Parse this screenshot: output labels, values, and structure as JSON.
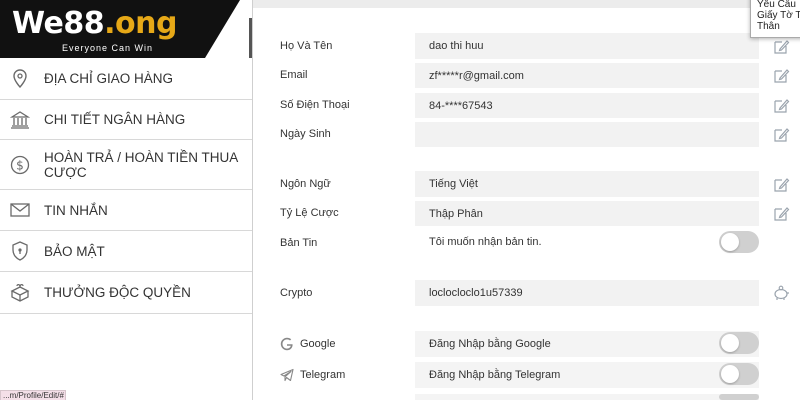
{
  "brand": {
    "name_main": "We88",
    "name_accent": ".ong",
    "tagline": "Everyone Can Win"
  },
  "sidebar": {
    "items": [
      {
        "label": "ĐỊA CHỈ GIAO HÀNG",
        "icon": "location-pin-icon"
      },
      {
        "label": "CHI TIẾT NGÂN HÀNG",
        "icon": "bank-icon"
      },
      {
        "label": "HOÀN TRẢ / HOÀN TIỀN THUA CƯỢC",
        "icon": "dollar-coin-icon"
      },
      {
        "label": "TIN NHẮN",
        "icon": "envelope-icon"
      },
      {
        "label": "BẢO MẬT",
        "icon": "shield-icon"
      },
      {
        "label": "THƯỞNG ĐỘC QUYỀN",
        "icon": "gift-box-icon"
      }
    ]
  },
  "profile": {
    "fields": [
      {
        "label": "Họ Và Tên",
        "value": "dao thi huu",
        "editable": true
      },
      {
        "label": "Email",
        "value": "zf*****r@gmail.com",
        "editable": true
      },
      {
        "label": "Số Điện Thoại",
        "value": "84-****67543",
        "editable": true
      },
      {
        "label": "Ngày Sinh",
        "value": "",
        "editable": true
      },
      {
        "label": "Ngôn Ngữ",
        "value": "Tiếng Việt",
        "editable": true
      },
      {
        "label": "Tỷ Lệ Cược",
        "value": "Thập Phân",
        "editable": true
      },
      {
        "label": "Bản Tin",
        "value": "Tôi muốn nhận bản tin.",
        "toggle_on": false
      },
      {
        "label": "Crypto",
        "value": "loclocloclo1u57339"
      }
    ],
    "social": [
      {
        "label": "Google",
        "value": "Đăng Nhập bằng Google",
        "icon": "google-icon",
        "toggle_on": false
      },
      {
        "label": "Telegram",
        "value": "Đăng Nhập bằng Telegram",
        "icon": "telegram-icon",
        "toggle_on": false
      }
    ]
  },
  "tooltip": {
    "line1": "Yêu Cầu",
    "line2": "Giấy Tờ Tùy",
    "line3": "Thân"
  },
  "status_url": "...m/Profile/Edit/#"
}
